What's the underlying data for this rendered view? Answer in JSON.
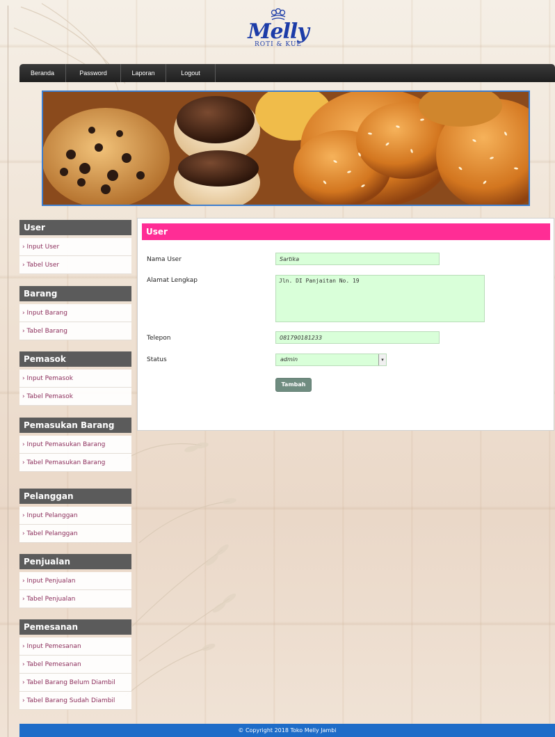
{
  "logo": {
    "brand": "Melly",
    "tagline": "ROTI & KUE"
  },
  "nav": {
    "items": [
      "Beranda",
      "Password",
      "Laporan",
      "Logout"
    ]
  },
  "sidebar": {
    "sections": [
      {
        "title": "User",
        "items": [
          "› Input User",
          "› Tabel User"
        ]
      },
      {
        "title": "Barang",
        "items": [
          "› Input Barang",
          "› Tabel Barang"
        ]
      },
      {
        "title": "Pemasok",
        "items": [
          "› Input Pemasok",
          "› Tabel Pemasok"
        ]
      },
      {
        "title": "Pemasukan Barang",
        "items": [
          "› Input Pemasukan Barang",
          "› Tabel Pemasukan Barang"
        ]
      },
      {
        "title": "Pelanggan",
        "items": [
          "› Input Pelanggan",
          "› Tabel Pelanggan"
        ]
      },
      {
        "title": "Penjualan",
        "items": [
          "› Input Penjualan",
          "› Tabel Penjualan"
        ]
      },
      {
        "title": "Pemesanan",
        "items": [
          "› Input Pemesanan",
          "› Tabel Pemesanan",
          "› Tabel Barang Belum Diambil",
          "› Tabel Barang Sudah Diambil"
        ]
      }
    ]
  },
  "main": {
    "title": "User",
    "form": {
      "nama_user_label": "Nama User",
      "nama_user_value": "Sartika",
      "alamat_label": "Alamat Lengkap",
      "alamat_value": "Jln. DI Panjaitan No. 19",
      "telepon_label": "Telepon",
      "telepon_value": "081790181233",
      "status_label": "Status",
      "status_value": "admin",
      "submit_label": "Tambah"
    }
  },
  "footer": {
    "text": "© Copyright 2018 Toko Melly Jambi"
  },
  "colors": {
    "nav_bg": "#2a2a2a",
    "sidebar_head": "#5b5b5b",
    "panel_head": "#ff2d95",
    "input_bg": "#d9ffd9",
    "button": "#6f8c80",
    "footer": "#1e6cc8",
    "banner_border": "#3d7ecf"
  }
}
